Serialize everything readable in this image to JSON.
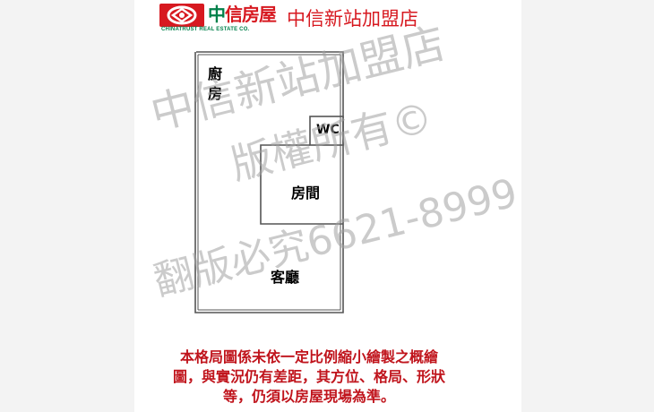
{
  "header": {
    "logo_cn_first": "中",
    "logo_cn_rest": "信房屋",
    "logo_en": "CHINATRUST REAL ESTATE CO.",
    "store_name": "中信新站加盟店"
  },
  "floorplan": {
    "rooms": {
      "kitchen": "廚房",
      "wc": "WC",
      "bedroom": "房間",
      "living": "客廳"
    }
  },
  "watermark": {
    "line1": "中信新站加盟店",
    "line2": "版權所有©",
    "line3": "翻版必究6621-8999"
  },
  "disclaimer": {
    "line1": "本格局圖係未依一定比例縮小繪製之概繪",
    "line2": "圖，與實況仍有差距，其方位、格局、形狀",
    "line3": "等，仍須以房屋現場為準。"
  },
  "colors": {
    "brand_red": "#d71920",
    "brand_green": "#00804a",
    "disclaimer_red": "#c0141c"
  }
}
